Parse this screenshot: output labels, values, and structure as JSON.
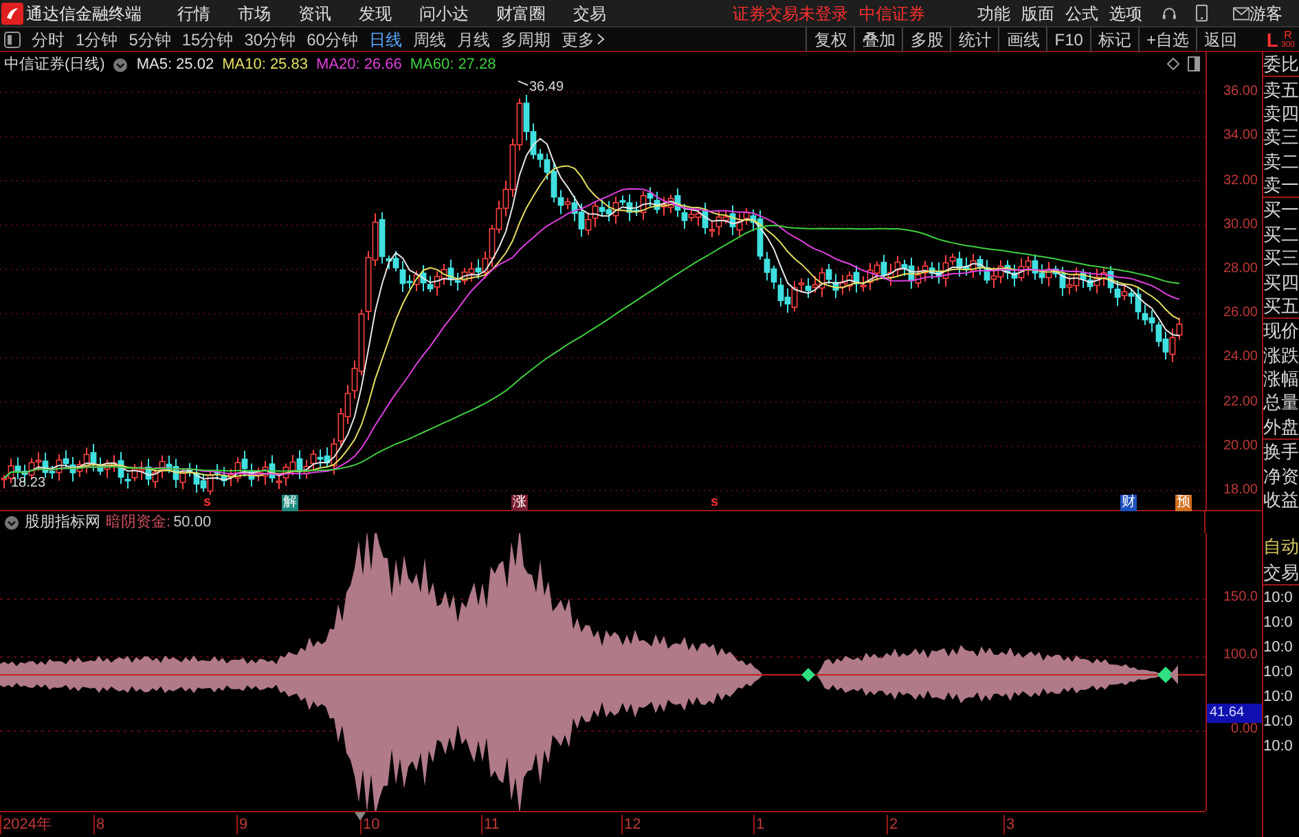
{
  "app_bar": {
    "title": "通达信金融终端",
    "menu": [
      "行情",
      "市场",
      "资讯",
      "发现",
      "问小达",
      "财富圈",
      "交易"
    ],
    "login_status": "证券交易未登录",
    "broker": "中信证券",
    "right_menu": [
      "功能",
      "版面",
      "公式",
      "选项"
    ],
    "user": "游客"
  },
  "toolbar": {
    "periods": [
      {
        "label": "分时",
        "selected": false
      },
      {
        "label": "1分钟",
        "selected": false
      },
      {
        "label": "5分钟",
        "selected": false
      },
      {
        "label": "15分钟",
        "selected": false
      },
      {
        "label": "30分钟",
        "selected": false
      },
      {
        "label": "60分钟",
        "selected": false
      },
      {
        "label": "日线",
        "selected": true
      },
      {
        "label": "周线",
        "selected": false
      },
      {
        "label": "月线",
        "selected": false
      },
      {
        "label": "多周期",
        "selected": false
      },
      {
        "label": "更多",
        "selected": false
      }
    ],
    "tools": [
      "复权",
      "叠加",
      "多股",
      "统计",
      "画线",
      "F10",
      "标记",
      "+自选",
      "返回"
    ],
    "side_left": "L",
    "side_right": "R",
    "side_count": "300"
  },
  "price_chart": {
    "title": "中信证券(日线)",
    "indicators": [
      {
        "label": "MA5: 25.02",
        "color": "#e8e8e8"
      },
      {
        "label": "MA10: 25.83",
        "color": "#e6e060"
      },
      {
        "label": "MA20: 26.66",
        "color": "#e040e0"
      },
      {
        "label": "MA60: 27.28",
        "color": "#40d040"
      }
    ],
    "high_label": "36.49",
    "low_label": "18.23",
    "y_axis": [
      "36.00",
      "34.00",
      "32.00",
      "30.00",
      "28.00",
      "26.00",
      "24.00",
      "22.00",
      "20.00",
      "18.00"
    ],
    "event_markers": [
      {
        "label": "s",
        "kind": "letter",
        "color": "#ff3030"
      },
      {
        "label": "解",
        "kind": "badge",
        "color": "#1f8a80"
      },
      {
        "label": "涨",
        "kind": "badge",
        "color": "#7a2030"
      },
      {
        "label": "s",
        "kind": "letter",
        "color": "#ff3030"
      },
      {
        "label": "财",
        "kind": "badge",
        "color": "#2050c0"
      },
      {
        "label": "预",
        "kind": "badge",
        "color": "#d07020"
      }
    ]
  },
  "indicator_chart": {
    "source": "股朋指标网",
    "name": "暗阴资金:",
    "value": "50.00",
    "y_axis": [
      "150.0",
      "100.0",
      "0.00"
    ],
    "current": "41.64"
  },
  "x_axis": [
    "2024年",
    "8",
    "9",
    "10",
    "11",
    "12",
    "1",
    "2",
    "3"
  ],
  "quote_panel": {
    "items": [
      "委比",
      "卖五",
      "卖四",
      "卖三",
      "卖二",
      "卖一",
      "买一",
      "买二",
      "买三",
      "买四",
      "买五",
      "现价",
      "涨跌",
      "涨幅",
      "总量",
      "外盘",
      "换手",
      "净资",
      "收益"
    ],
    "mode": "自动",
    "trade": "交易",
    "times": [
      "10:0",
      "10:0",
      "10:0",
      "10:0",
      "10:0",
      "10:0",
      "10:0"
    ]
  }
}
